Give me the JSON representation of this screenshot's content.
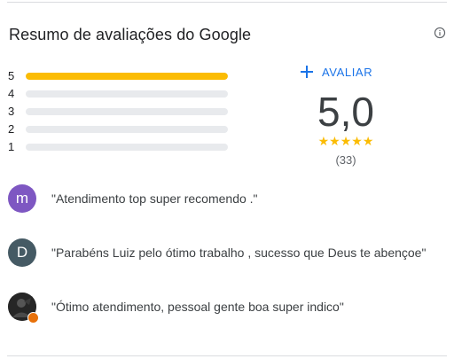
{
  "header": {
    "title": "Resumo de avaliações do Google",
    "info_icon": "info-icon"
  },
  "distribution": [
    {
      "stars": "5",
      "fraction": 1.0
    },
    {
      "stars": "4",
      "fraction": 0.0
    },
    {
      "stars": "3",
      "fraction": 0.0
    },
    {
      "stars": "2",
      "fraction": 0.0
    },
    {
      "stars": "1",
      "fraction": 0.0
    }
  ],
  "write_review": {
    "icon": "plus-icon",
    "label": "AVALIAR"
  },
  "summary": {
    "score": "5,0",
    "stars": "★★★★★",
    "count": "(33)"
  },
  "reviews": [
    {
      "avatar_letter": "m",
      "avatar_color": "#7e57c2",
      "text": "\"Atendimento top super recomendo .\""
    },
    {
      "avatar_letter": "D",
      "avatar_color": "#455a64",
      "text": "\"Parabéns Luiz pelo ótimo trabalho , sucesso que Deus te abençoe\""
    },
    {
      "avatar_letter": "",
      "avatar_color": "#2b2b2b",
      "text": "\"Ótimo atendimento, pessoal gente boa super indico\""
    }
  ],
  "colors": {
    "accent": "#1a73e8",
    "star": "#fbbc04",
    "track": "#e8eaed"
  }
}
